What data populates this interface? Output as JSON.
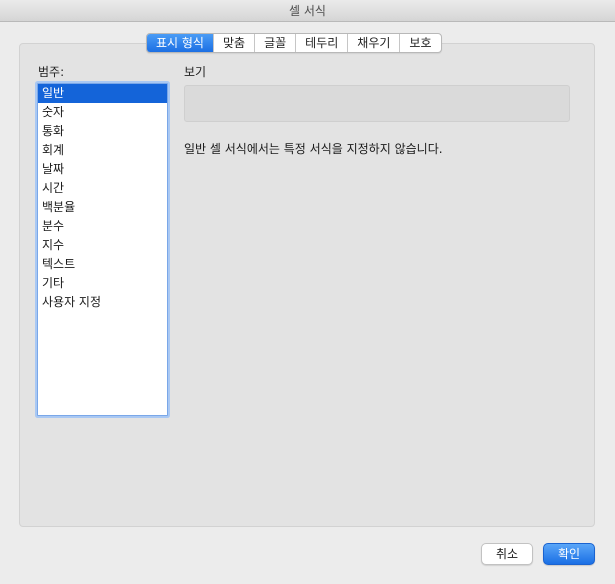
{
  "window": {
    "title": "셀 서식"
  },
  "tabs": [
    {
      "label": "표시 형식",
      "active": true
    },
    {
      "label": "맞춤",
      "active": false
    },
    {
      "label": "글꼴",
      "active": false
    },
    {
      "label": "테두리",
      "active": false
    },
    {
      "label": "채우기",
      "active": false
    },
    {
      "label": "보호",
      "active": false
    }
  ],
  "category": {
    "label": "범주:",
    "items": [
      "일반",
      "숫자",
      "통화",
      "회계",
      "날짜",
      "시간",
      "백분율",
      "분수",
      "지수",
      "텍스트",
      "기타",
      "사용자 지정"
    ],
    "selected_index": 0
  },
  "preview": {
    "label": "보기",
    "value": ""
  },
  "description": "일반 셀 서식에서는 특정 서식을 지정하지 않습니다.",
  "buttons": {
    "cancel": "취소",
    "ok": "확인"
  },
  "colors": {
    "accent": "#1464d9",
    "panel": "#e3e3e3",
    "window": "#ececec"
  }
}
